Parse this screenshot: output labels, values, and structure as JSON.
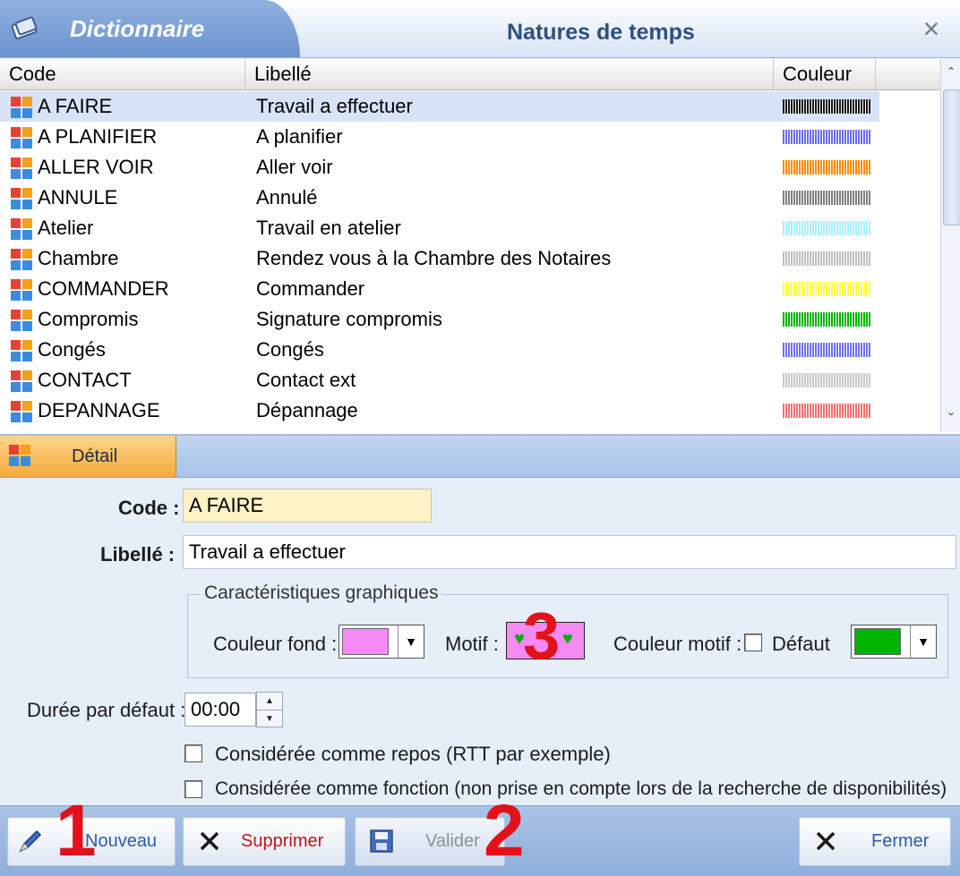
{
  "window": {
    "tab_title": "Dictionnaire",
    "title": "Natures de temps",
    "close_symbol": "×"
  },
  "grid": {
    "columns": [
      "Code",
      "Libellé",
      "Couleur"
    ],
    "rows": [
      {
        "code": "A FAIRE",
        "libelle": "Travail a effectuer",
        "color": "#1a1a1a",
        "selected": true
      },
      {
        "code": "A PLANIFIER",
        "libelle": "A planifier",
        "color": "#6b6bf0"
      },
      {
        "code": "ALLER VOIR",
        "libelle": "Aller voir",
        "color": "#ff8a00"
      },
      {
        "code": "ANNULE",
        "libelle": "Annulé",
        "color": "#808080"
      },
      {
        "code": "Atelier",
        "libelle": "Travail en atelier",
        "color": "#a8f0ff"
      },
      {
        "code": "Chambre",
        "libelle": "Rendez vous à la Chambre des Notaires",
        "color": "#c0c0c0"
      },
      {
        "code": "COMMANDER",
        "libelle": "Commander",
        "color": "#ffff40"
      },
      {
        "code": "Compromis",
        "libelle": "Signature compromis",
        "color": "#00b400"
      },
      {
        "code": "Congés",
        "libelle": "Congés",
        "color": "#7070f0"
      },
      {
        "code": "CONTACT",
        "libelle": "Contact ext",
        "color": "#c8c8c8"
      },
      {
        "code": "DEPANNAGE",
        "libelle": "Dépannage",
        "color": "#f07070"
      }
    ]
  },
  "detail_tab": "Détail",
  "form": {
    "code_label": "Code :",
    "code_value": "A FAIRE",
    "libelle_label": "Libellé :",
    "libelle_value": "Travail a effectuer",
    "group_legend": "Caractéristiques graphiques",
    "couleur_fond_label": "Couleur fond :",
    "couleur_fond_value": "#f58af5",
    "motif_label": "Motif :",
    "couleur_motif_label": "Couleur motif :",
    "defaut_label": "Défaut",
    "couleur_motif_value": "#00b400",
    "duree_label": "Durée par défaut :",
    "duree_value": "00:00",
    "repos_label": "Considérée comme repos (RTT par exemple)",
    "fonction_label": "Considérée comme fonction (non prise en compte lors de la recherche de disponibilités)"
  },
  "buttons": {
    "nouveau": "Nouveau",
    "supprimer": "Supprimer",
    "valider": "Valider",
    "fermer": "Fermer"
  },
  "annotations": {
    "one": "1",
    "two": "2",
    "three": "3"
  }
}
